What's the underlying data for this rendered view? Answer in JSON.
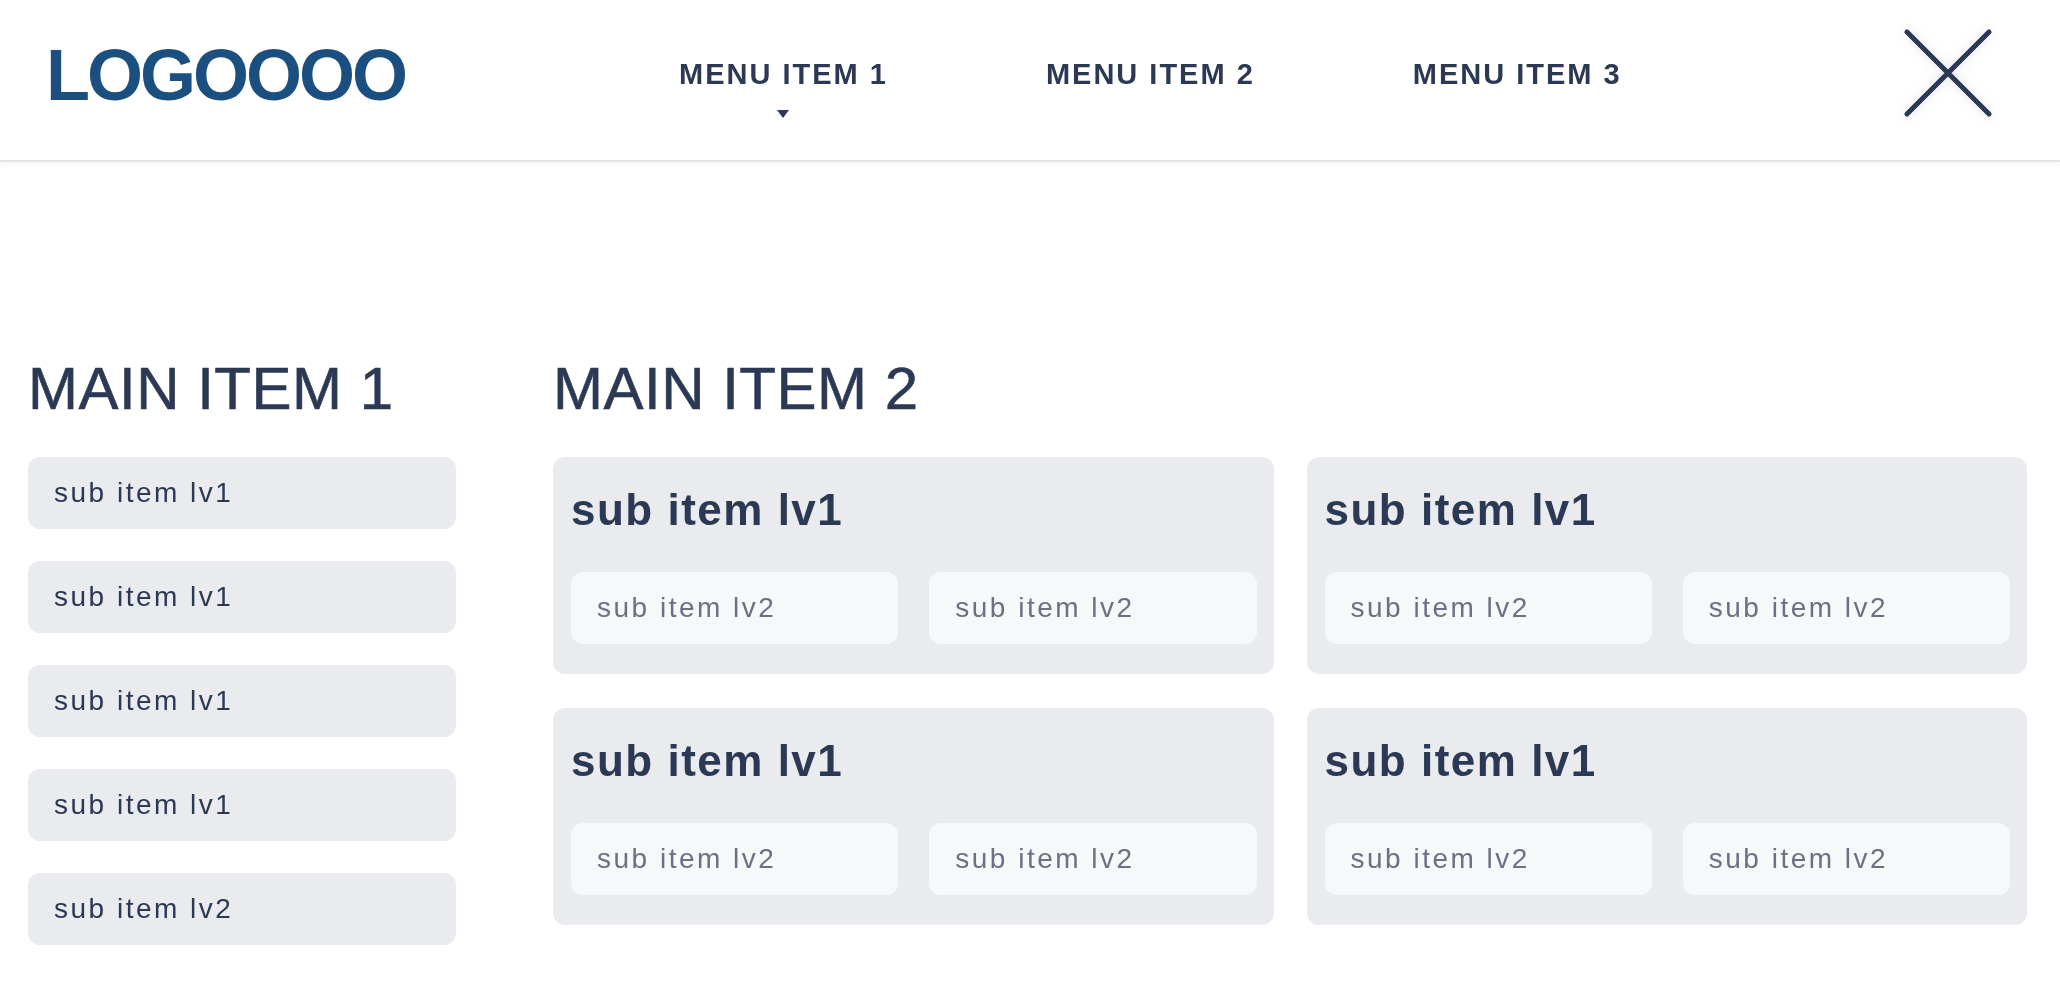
{
  "header": {
    "logo": "LOGOOOO",
    "menu": [
      {
        "label": "MENU ITEM 1",
        "expanded": true
      },
      {
        "label": "MENU ITEM 2",
        "expanded": false
      },
      {
        "label": "MENU ITEM 3",
        "expanded": false
      }
    ]
  },
  "sections": [
    {
      "title": "MAIN ITEM 1",
      "kind": "list",
      "items": [
        "sub item lv1",
        "sub item lv1",
        "sub item lv1",
        "sub item lv1",
        "sub item lv2"
      ]
    },
    {
      "title": "MAIN ITEM 2",
      "kind": "cards",
      "cards": [
        {
          "title": "sub item lv1",
          "items": [
            "sub item lv2",
            "sub item lv2"
          ]
        },
        {
          "title": "sub item lv1",
          "items": [
            "sub item lv2",
            "sub item lv2"
          ]
        },
        {
          "title": "sub item lv1",
          "items": [
            "sub item lv2",
            "sub item lv2"
          ]
        },
        {
          "title": "sub item lv1",
          "items": [
            "sub item lv2",
            "sub item lv2"
          ]
        }
      ]
    }
  ]
}
